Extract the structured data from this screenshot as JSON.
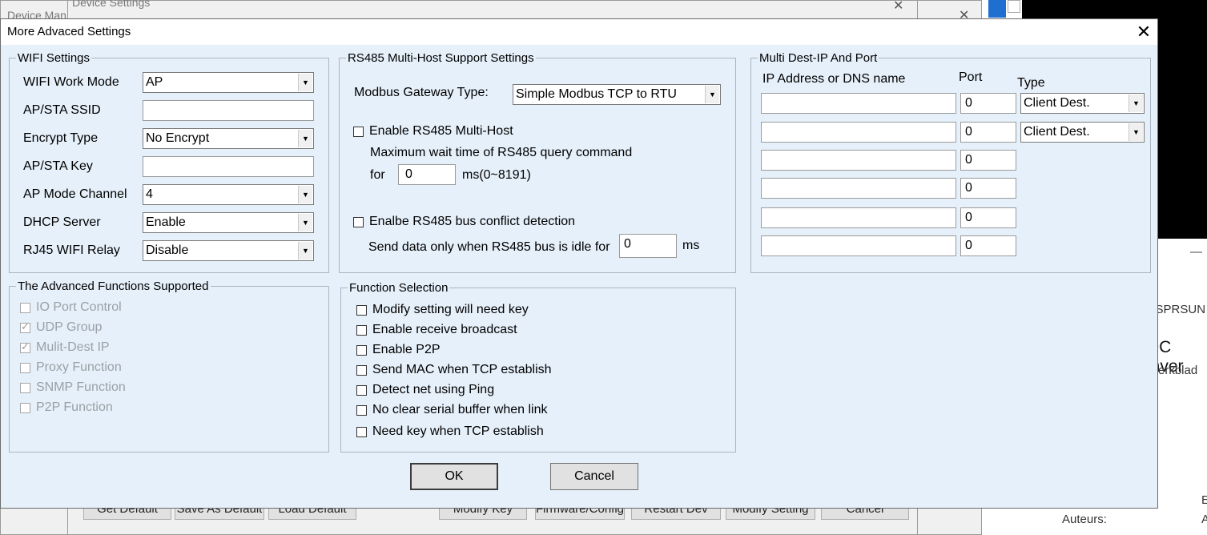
{
  "background": {
    "device_manager_title": "Device Man",
    "device_settings_title": "Device Settings",
    "close_glyph": "✕",
    "bottom_buttons": [
      "Get Default",
      "Save As Default",
      "Load Default",
      "Modify Key",
      "Firmware/Config",
      "Restart Dev",
      "Modify Setting",
      "Cancel"
    ],
    "right_pane": {
      "line1": "n SPRSUN",
      "line2": "DC inver",
      "line3": "erkblad",
      "line4": "Auteurs:",
      "line5": "E",
      "line6": "A",
      "dash": "—"
    }
  },
  "dialog": {
    "title": "More Advaced Settings",
    "close_glyph": "✕"
  },
  "wifi": {
    "legend": "WIFI Settings",
    "work_mode_label": "WIFI Work Mode",
    "work_mode_value": "AP",
    "ssid_label": "AP/STA SSID",
    "ssid_value": "",
    "encrypt_label": "Encrypt Type",
    "encrypt_value": "No Encrypt",
    "key_label": "AP/STA Key",
    "key_value": "",
    "channel_label": "AP Mode Channel",
    "channel_value": "4",
    "dhcp_label": "DHCP Server",
    "dhcp_value": "Enable",
    "relay_label": "RJ45 WIFI Relay",
    "relay_value": "Disable"
  },
  "rs485": {
    "legend": "RS485 Multi-Host Support Settings",
    "gateway_label": "Modbus Gateway Type:",
    "gateway_value": "Simple Modbus TCP to RTU",
    "multi_host_label": "Enable RS485 Multi-Host",
    "wait_label": "Maximum wait time of RS485  query command",
    "for_label": "for",
    "wait_value": "0",
    "wait_unit": "ms(0~8191)",
    "conflict_label": "Enalbe RS485 bus conflict detection",
    "idle_label": "Send data only when RS485 bus is idle for",
    "idle_value": "0",
    "idle_unit": "ms"
  },
  "multi_dest": {
    "legend": "Multi Dest-IP And Port",
    "col_ip": "IP Address or DNS name",
    "col_port": "Port",
    "col_type": "Type",
    "rows": [
      {
        "ip": "",
        "port": "0",
        "type": "Client Dest."
      },
      {
        "ip": "",
        "port": "0",
        "type": "Client Dest."
      },
      {
        "ip": "",
        "port": "0"
      },
      {
        "ip": "",
        "port": "0"
      },
      {
        "ip": "",
        "port": "0"
      },
      {
        "ip": "",
        "port": "0"
      }
    ]
  },
  "advanced": {
    "legend": "The Advanced Functions Supported",
    "items": [
      {
        "label": "IO Port Control",
        "checked": false
      },
      {
        "label": "UDP Group",
        "checked": true
      },
      {
        "label": "Mulit-Dest IP",
        "checked": true
      },
      {
        "label": "Proxy Function",
        "checked": false
      },
      {
        "label": "SNMP Function",
        "checked": false
      },
      {
        "label": "P2P Function",
        "checked": false
      }
    ],
    "check_glyph": "✓"
  },
  "function_sel": {
    "legend": "Function Selection",
    "items": [
      {
        "label": "Modify setting will need key"
      },
      {
        "label": "Enable receive broadcast"
      },
      {
        "label": "Enable P2P"
      },
      {
        "label": "Send MAC when TCP establish"
      },
      {
        "label": "Detect net using Ping"
      },
      {
        "label": "No clear serial buffer when link"
      },
      {
        "label": "Need key when TCP establish"
      }
    ]
  },
  "buttons": {
    "ok": "OK",
    "cancel": "Cancel"
  },
  "glyphs": {
    "combo_arrow": "▼"
  }
}
